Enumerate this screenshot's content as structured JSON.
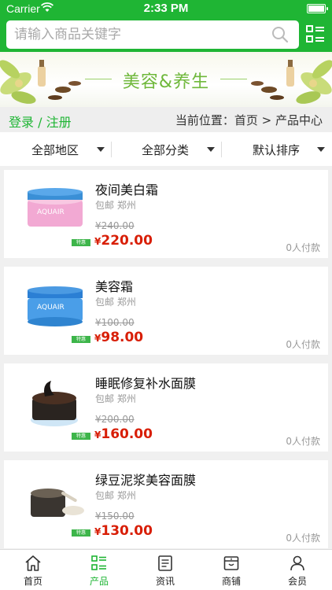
{
  "status": {
    "carrier": "Carrier",
    "time": "2:33 PM"
  },
  "search": {
    "placeholder": "请输入商品关键字"
  },
  "banner": {
    "title": "美容&养生"
  },
  "infobar": {
    "login": "登录 / 注册",
    "location": "当前位置：首页 > 产品中心"
  },
  "filters": [
    {
      "label": "全部地区"
    },
    {
      "label": "全部分类"
    },
    {
      "label": "默认排序"
    }
  ],
  "products": [
    {
      "name": "夜间美白霜",
      "shipping": "包邮 郑州",
      "original_price": "¥240.00",
      "price": "220.00",
      "currency": "¥",
      "buyers": "0人付款",
      "badge": "特惠",
      "jar_color": "#f2a9d3",
      "lid_color": "#3a8fd6"
    },
    {
      "name": "美容霜",
      "shipping": "包邮 郑州",
      "original_price": "¥100.00",
      "price": "98.00",
      "currency": "¥",
      "buyers": "0人付款",
      "badge": "特惠",
      "jar_color": "#4a9ee8",
      "lid_color": "#2b7fd4"
    },
    {
      "name": "睡眠修复补水面膜",
      "shipping": "包邮 郑州",
      "original_price": "¥200.00",
      "price": "160.00",
      "currency": "¥",
      "buyers": "0人付款",
      "badge": "特惠",
      "jar_color": "#2a2420",
      "lid_color": "#1b1715"
    },
    {
      "name": "绿豆泥浆美容面膜",
      "shipping": "包邮 郑州",
      "original_price": "¥150.00",
      "price": "130.00",
      "currency": "¥",
      "buyers": "0人付款",
      "badge": "特惠",
      "jar_color": "#3a3530",
      "lid_color": "#222"
    }
  ],
  "nav": [
    {
      "label": "首页",
      "icon": "home-icon",
      "active": false
    },
    {
      "label": "产品",
      "icon": "product-icon",
      "active": true
    },
    {
      "label": "资讯",
      "icon": "news-icon",
      "active": false
    },
    {
      "label": "商铺",
      "icon": "shop-icon",
      "active": false
    },
    {
      "label": "会员",
      "icon": "member-icon",
      "active": false
    }
  ],
  "colors": {
    "brand": "#1fb534",
    "price": "#d81e06"
  }
}
